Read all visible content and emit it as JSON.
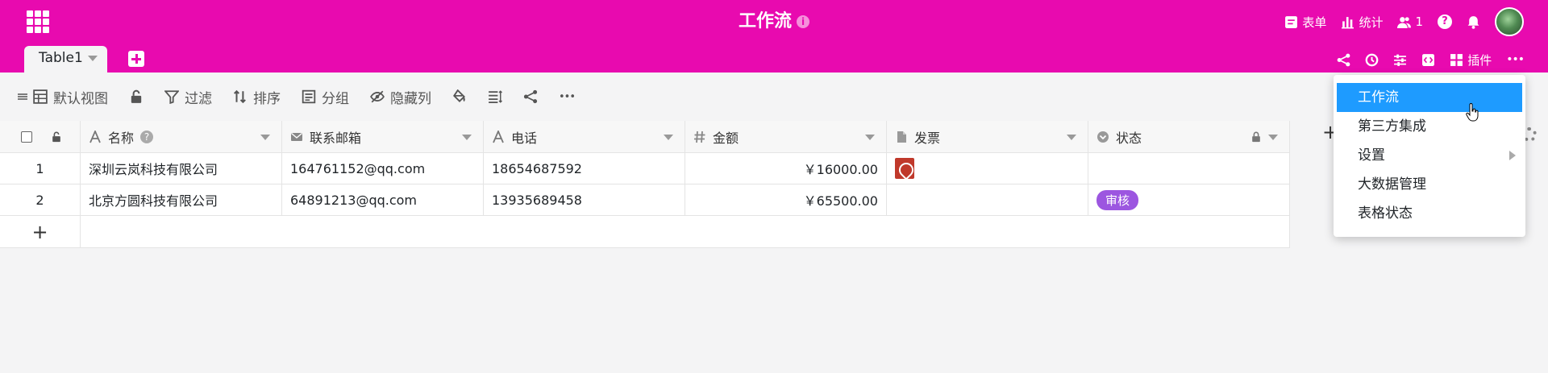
{
  "header": {
    "title": "工作流",
    "info_glyph": "i",
    "right_items": [
      {
        "icon": "form-icon",
        "label": "表单"
      },
      {
        "icon": "chart-icon",
        "label": "统计"
      },
      {
        "icon": "users-icon",
        "label": "1"
      }
    ],
    "help_glyph": "?",
    "plugin_label": "插件",
    "more_glyph": "•••"
  },
  "tabs": [
    {
      "label": "Table1",
      "active": true
    }
  ],
  "toolbar": {
    "view_label": "默认视图",
    "filter_label": "过滤",
    "sort_label": "排序",
    "group_label": "分组",
    "hide_label": "隐藏列",
    "more_glyph": "•••"
  },
  "table": {
    "columns": [
      {
        "name": "名称",
        "icon": "text-icon"
      },
      {
        "name": "联系邮箱",
        "icon": "email-icon"
      },
      {
        "name": "电话",
        "icon": "text-icon"
      },
      {
        "name": "金额",
        "icon": "number-icon"
      },
      {
        "name": "发票",
        "icon": "file-icon"
      },
      {
        "name": "状态",
        "icon": "single-select-icon"
      }
    ],
    "rows": [
      {
        "index": "1",
        "name": "深圳云岚科技有限公司",
        "email": "164761152@qq.com",
        "phone": "18654687592",
        "amount": "￥16000.00",
        "invoice": "pdf",
        "status": ""
      },
      {
        "index": "2",
        "name": "北京方圆科技有限公司",
        "email": "64891213@qq.com",
        "phone": "13935689458",
        "amount": "￥65500.00",
        "invoice": "",
        "status": "审核"
      }
    ],
    "add_row_glyph": "+",
    "add_col_glyph": "+"
  },
  "menu": {
    "items": [
      {
        "label": "工作流",
        "active": true
      },
      {
        "label": "第三方集成"
      },
      {
        "label": "设置",
        "submenu": true
      },
      {
        "label": "大数据管理"
      },
      {
        "label": "表格状态"
      }
    ]
  },
  "colors": {
    "brand": "#e80aaf",
    "menu_active": "#1e9bff",
    "status_badge": "#9c56e0"
  }
}
